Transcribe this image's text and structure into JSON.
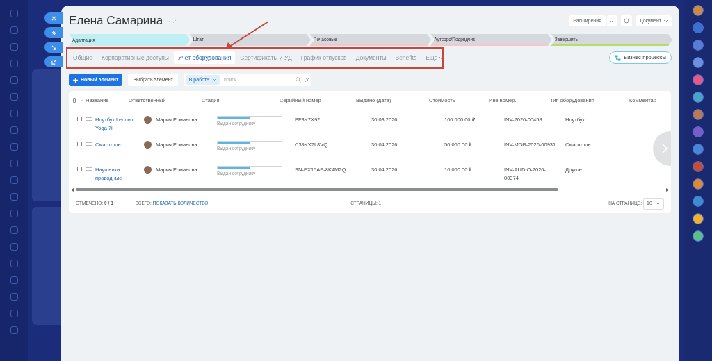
{
  "panel": {
    "title": "Елена Самарина",
    "header_buttons": [
      {
        "kind": "dropdown",
        "label": "Расширения"
      },
      {
        "kind": "gear"
      },
      {
        "kind": "menu",
        "label": "Документ"
      }
    ]
  },
  "stages": [
    {
      "label": "Адаптация",
      "selected": true,
      "color": "#bfeef5"
    },
    {
      "label": "Штат",
      "selected": false,
      "color": "#d5d8dc"
    },
    {
      "label": "Почасовые",
      "selected": false,
      "color": "#f4c7cf"
    },
    {
      "label": "Аутсорс/Подрядчик",
      "selected": false,
      "color": "#f4c7cf"
    },
    {
      "label": "Завершить",
      "selected": false,
      "color": "#b6dc6a"
    }
  ],
  "tabs": [
    {
      "label": "Общие",
      "selected": false
    },
    {
      "label": "Корпоративные доступы",
      "selected": false
    },
    {
      "label": "Учет оборудования",
      "selected": true
    },
    {
      "label": "Сертификаты и УД",
      "selected": false
    },
    {
      "label": "График отпусков",
      "selected": false
    },
    {
      "label": "Документы",
      "selected": false
    },
    {
      "label": "Benefits",
      "selected": false
    },
    {
      "label": "Еще",
      "selected": false,
      "kind": "more"
    }
  ],
  "process_button": "Бизнес-процессы",
  "toolbar": {
    "new_button": "Новый элемент",
    "select_button": "Выбрать элемент",
    "filter_chip": "В работе",
    "search": {
      "placeholder": "поиск"
    }
  },
  "table": {
    "all_checked": false,
    "columns": [
      "Название",
      "Ответственный",
      "Стадия",
      "Серийный номер",
      "Выдано (дата)",
      "Стоимость",
      "Инв.номер.",
      "Тип оборудования",
      "Комментар"
    ],
    "rows": [
      {
        "checked": false,
        "name": "Ноутбук Lenovo Yoga 7i",
        "person": "Мария Романова",
        "level": 0.5,
        "stage": "Выдан сотруднику",
        "serial": "PF3K7X92",
        "date": "30.03.2026",
        "cost": "100 000.00 ₽",
        "inv": "INV-2026-00458",
        "type": "Ноутбук"
      },
      {
        "checked": false,
        "name": "Смартфон",
        "person": "Мария Романова",
        "level": 0.5,
        "stage": "Выдан сотруднику",
        "serial": "C39KX2L8VQ",
        "date": "30.04.2026",
        "cost": "50 000.00 ₽",
        "inv": "INV-MOB-2026-00931",
        "type": "Смартфон"
      },
      {
        "checked": false,
        "name": "Наушники проводные",
        "person": "Мария Романова",
        "level": 0.5,
        "stage": "Выдан сотруднику",
        "serial": "SN-EX15AP-8K4M2Q",
        "date": "30.04.2026",
        "cost": "10 000.00 ₽",
        "inv": "INV-AUDIO-2026-00374",
        "type": "Другое"
      }
    ]
  },
  "footer": {
    "marked_label": "ОТМЕЧЕНО:",
    "marked_value": "0 / 3",
    "total_label": "ВСЕГО:",
    "total_link": "ПОКАЗАТЬ КОЛИЧЕСТВО",
    "pages": "СТРАНИЦЫ: 1",
    "per_page_label": "НА СТРАНИЦЕ:",
    "per_page": "10"
  }
}
